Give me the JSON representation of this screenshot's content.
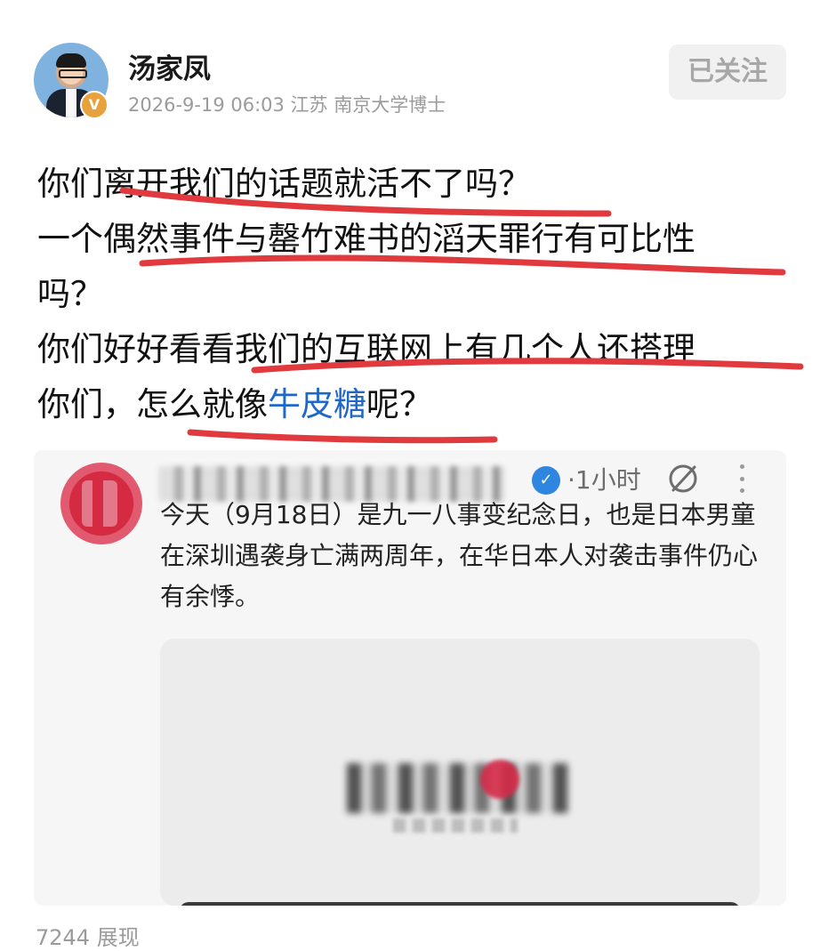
{
  "author": {
    "name": "汤家凤",
    "badge": "V",
    "meta": "2026-9-19 06:03 江苏 南京大学博士",
    "follow_label": "已关注"
  },
  "post": {
    "lines": [
      "你们离开我们的话题就活不了吗？",
      "一个偶然事件与罄竹难书的滔天罪行有可比性",
      "吗？",
      "你们好好看看我们的互联网上有几个人还搭理",
      "你们，怎么就像"
    ],
    "link_text": "牛皮糖",
    "tail_text": "呢？",
    "underline_color": "#e03a3f",
    "link_color": "#1f67c8"
  },
  "quoted": {
    "verified_icon": "check-icon",
    "time": "·1小时",
    "mute_icon": "mute-icon",
    "more_icon": "more-vertical-icon",
    "text": "今天（9月18日）是九一八事变纪念日，也是日本男童在深圳遇袭身亡满两周年，在华日本人对袭击事件仍心有余悸。"
  },
  "footer": {
    "views": "7244 展现"
  }
}
